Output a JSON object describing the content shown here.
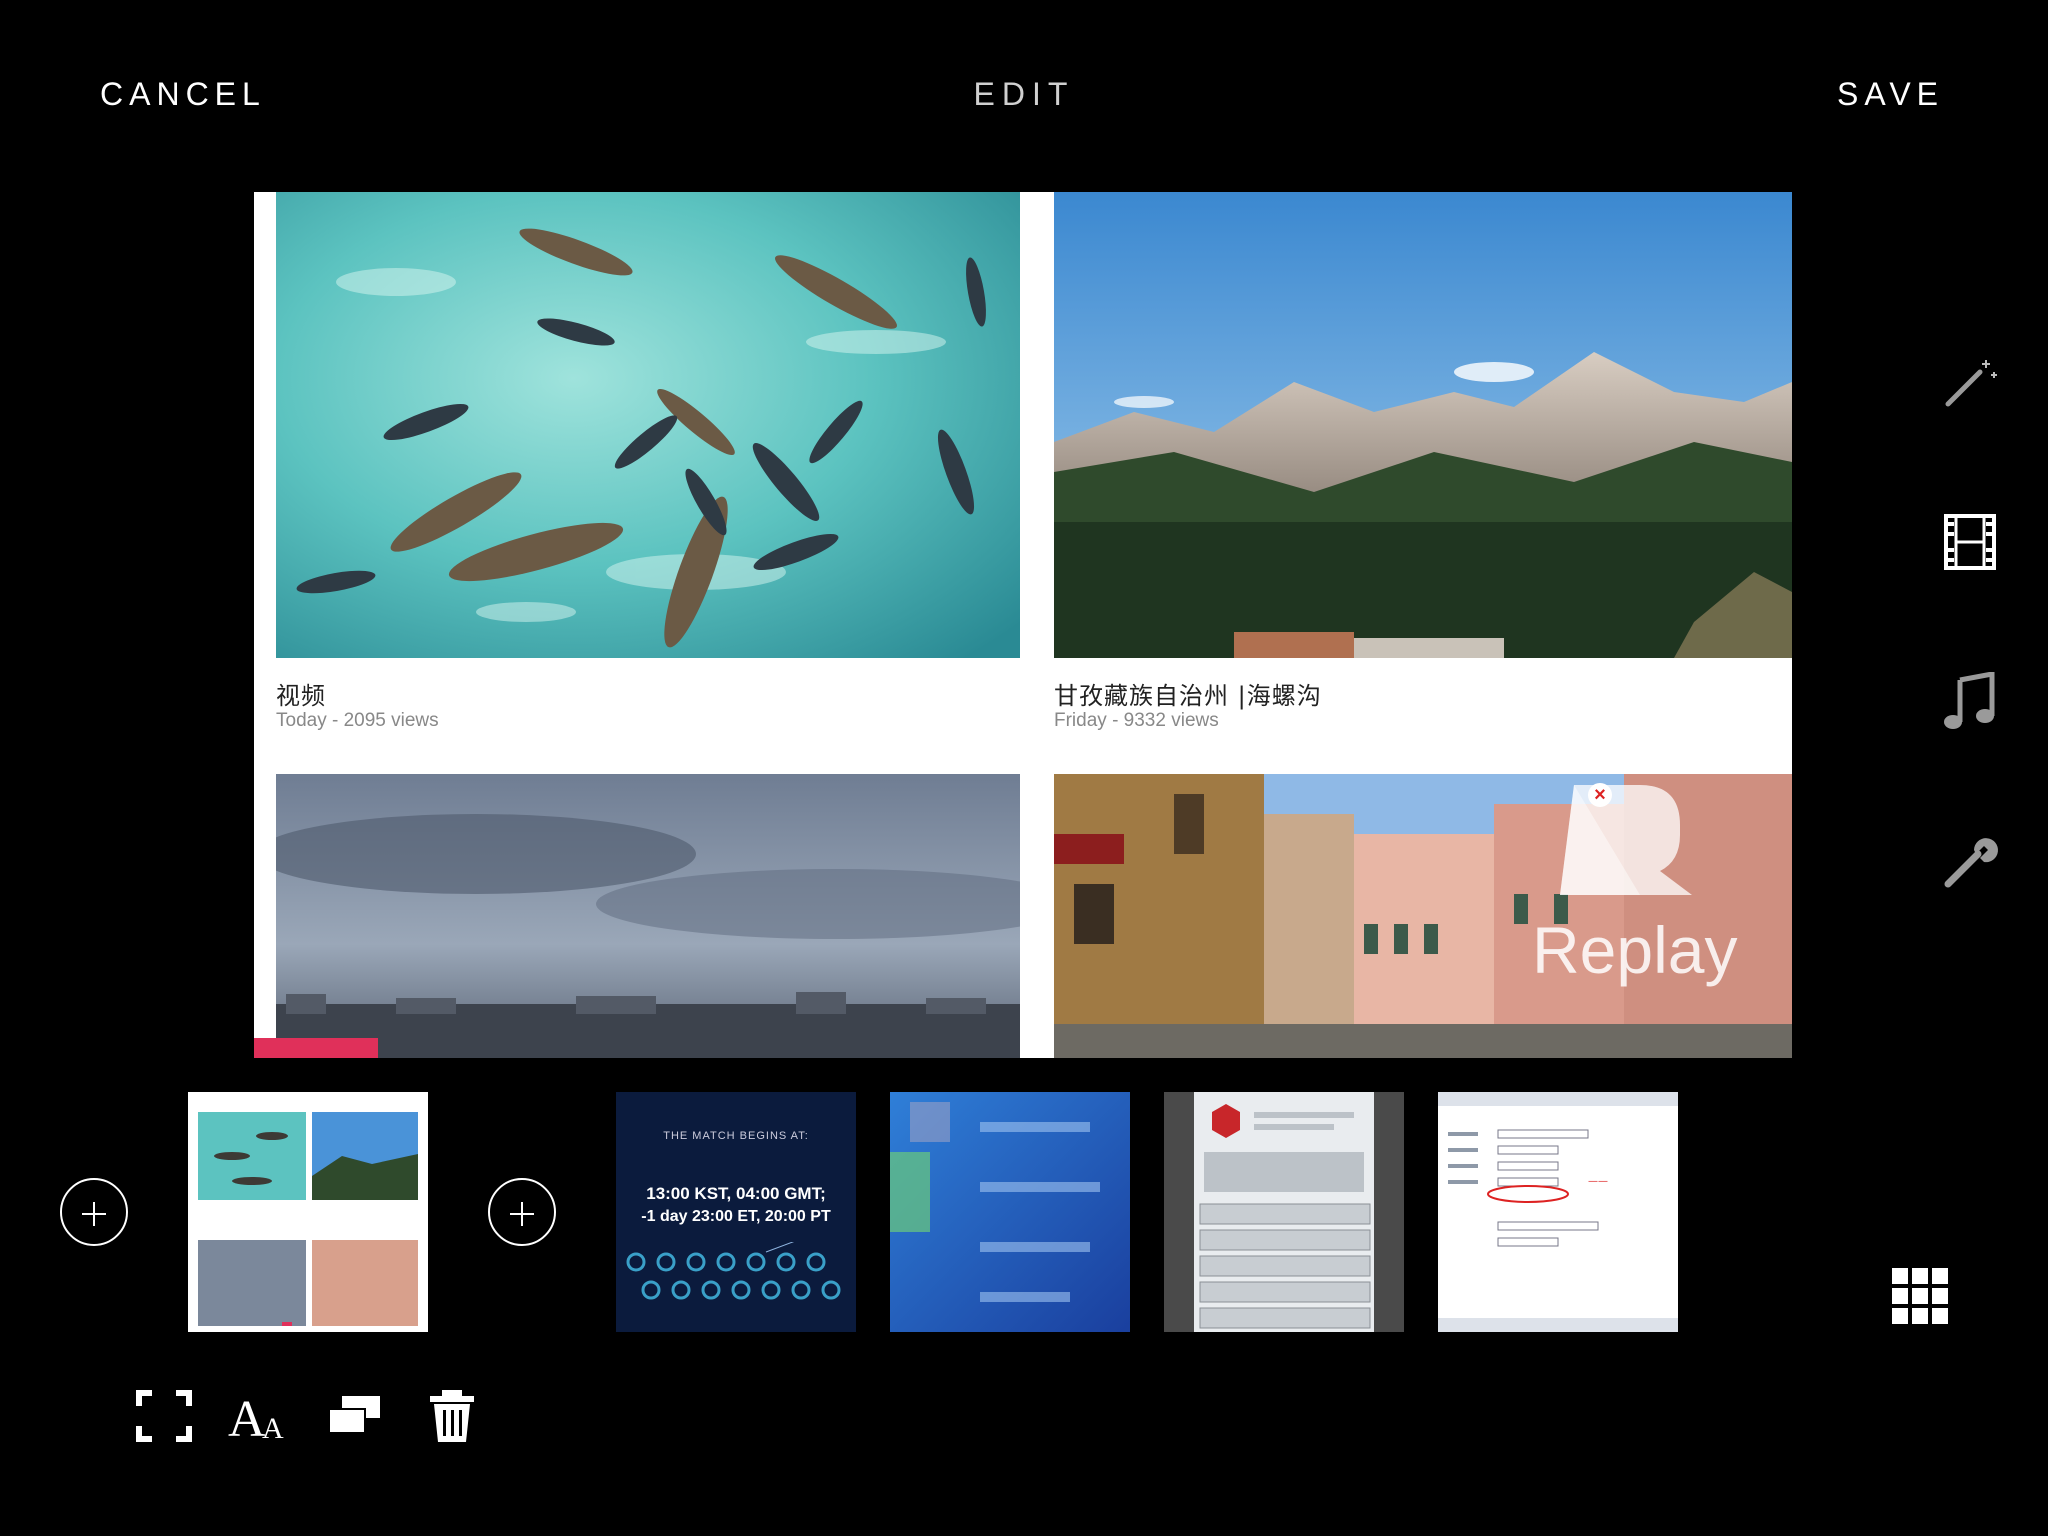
{
  "header": {
    "cancel_label": "CANCEL",
    "title": "EDIT",
    "save_label": "SAVE"
  },
  "preview": {
    "cards": [
      {
        "title": "视频",
        "meta": "Today - 2095 views"
      },
      {
        "title": "甘孜藏族自治州 |海螺沟",
        "meta": "Friday - 9332 views"
      }
    ],
    "replay_label": "Replay"
  },
  "filmstrip": {
    "match_thumb": {
      "heading": "THE MATCH BEGINS AT:",
      "line1": "13:00 KST, 04:00 GMT;",
      "line2": "-1 day 23:00 ET, 20:00 PT"
    }
  },
  "colors": {
    "background": "#000000",
    "accent": "#e0305a"
  },
  "icons": {
    "right_toolbar": [
      "magic-wand-icon",
      "film-icon",
      "music-note-icon",
      "wrench-icon"
    ],
    "bottom_toolbar": [
      "crop-frame-icon",
      "text-size-icon",
      "layers-icon",
      "trash-icon"
    ],
    "grid": "grid-icon"
  }
}
